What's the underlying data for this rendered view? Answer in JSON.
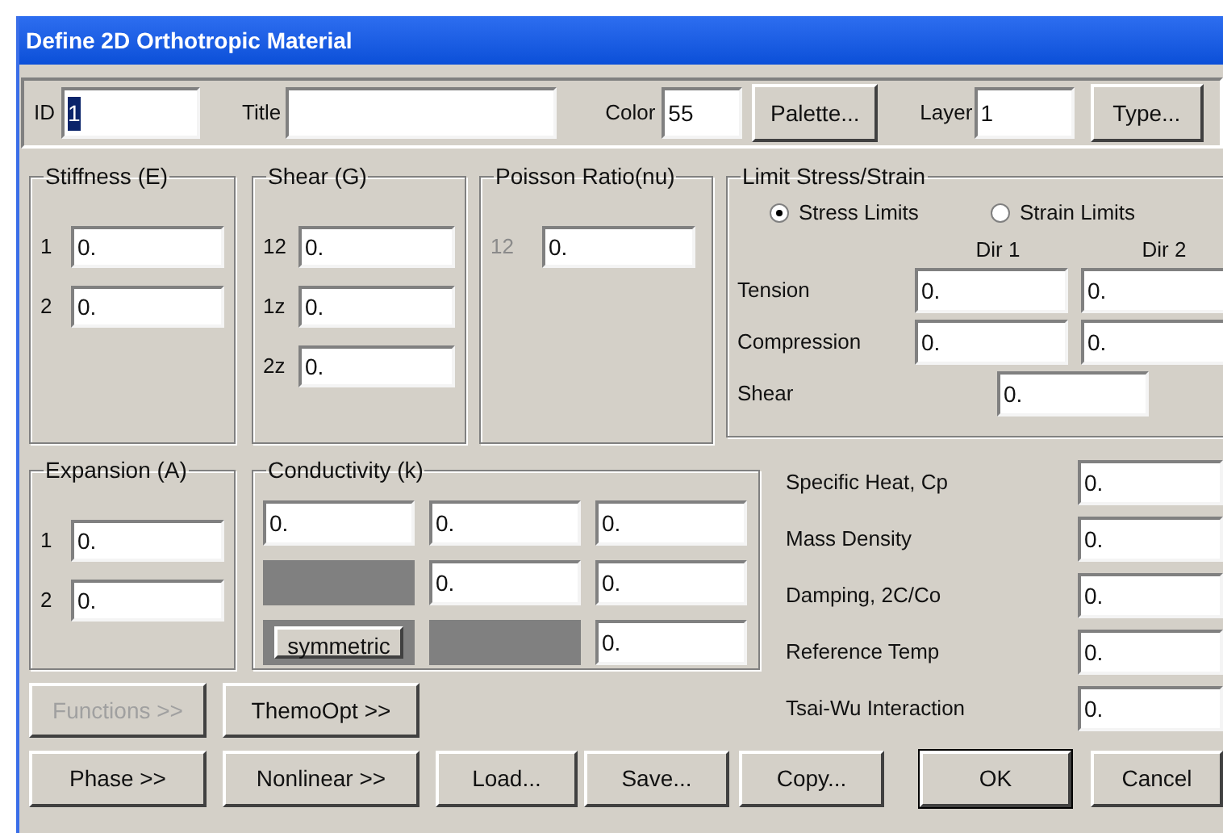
{
  "window": {
    "title": "Define 2D Orthotropic Material"
  },
  "header": {
    "id": {
      "label": "ID",
      "value": "1",
      "text_selected": true
    },
    "title": {
      "label": "Title"
    },
    "color": {
      "label": "Color",
      "value": "55"
    },
    "palette_button": "Palette...",
    "layer": {
      "label": "Layer",
      "value": "1"
    },
    "type_button": "Type..."
  },
  "stiffness": {
    "title": "Stiffness (E)",
    "rows": [
      {
        "label": "1",
        "value": "0.",
        "disabled": false
      },
      {
        "label": "2",
        "value": "0.",
        "disabled": false
      }
    ]
  },
  "shear": {
    "title": "Shear (G)",
    "rows": [
      {
        "label": "12",
        "value": "0.",
        "disabled": false
      },
      {
        "label": "1z",
        "value": "0.",
        "disabled": false
      },
      {
        "label": "2z",
        "value": "0.",
        "disabled": false
      }
    ]
  },
  "poisson": {
    "title": "Poisson Ratio(nu)",
    "rows": [
      {
        "label": "12",
        "value": "0.",
        "disabled": true
      }
    ]
  },
  "limits": {
    "title": "Limit Stress/Strain",
    "options": [
      {
        "label": "Stress Limits",
        "selected": true
      },
      {
        "label": "Strain Limits",
        "selected": false
      }
    ],
    "columns": [
      "Dir 1",
      "Dir 2"
    ],
    "rows": [
      {
        "label": "Tension",
        "values": [
          "0.",
          "0."
        ]
      },
      {
        "label": "Compression",
        "values": [
          "0.",
          "0."
        ]
      }
    ],
    "shear": {
      "label": "Shear",
      "value": "0."
    }
  },
  "expansion": {
    "title": "Expansion (A)",
    "rows": [
      {
        "label": "1",
        "value": "0.",
        "disabled": false
      },
      {
        "label": "2",
        "value": "0.",
        "disabled": false
      }
    ]
  },
  "conductivity": {
    "title": "Conductivity (k)",
    "cells": [
      [
        {
          "kind": "field",
          "value": "0."
        },
        {
          "kind": "field",
          "value": "0."
        },
        {
          "kind": "field",
          "value": "0."
        }
      ],
      [
        {
          "kind": "blank"
        },
        {
          "kind": "field",
          "value": "0."
        },
        {
          "kind": "field",
          "value": "0."
        }
      ],
      [
        {
          "kind": "button",
          "label": "symmetric"
        },
        {
          "kind": "blank"
        },
        {
          "kind": "field",
          "value": "0."
        }
      ]
    ]
  },
  "properties": [
    {
      "label": "Specific Heat, Cp",
      "value": "0."
    },
    {
      "label": "Mass Density",
      "value": "0."
    },
    {
      "label": "Damping, 2C/Co",
      "value": "0."
    },
    {
      "label": "Reference Temp",
      "value": "0."
    },
    {
      "label": "Tsai-Wu Interaction",
      "value": "0."
    }
  ],
  "option_buttons": [
    {
      "label": "Functions >>",
      "disabled": true
    },
    {
      "label": "ThemoOpt >>",
      "disabled": false
    }
  ],
  "buttons": [
    {
      "label": "Phase >>",
      "default": false
    },
    {
      "label": "Nonlinear >>",
      "default": false
    },
    {
      "label": "Load...",
      "default": false
    },
    {
      "label": "Save...",
      "default": false
    },
    {
      "label": "Copy...",
      "default": false
    },
    {
      "label": "OK",
      "default": true
    },
    {
      "label": "Cancel",
      "default": false
    }
  ]
}
